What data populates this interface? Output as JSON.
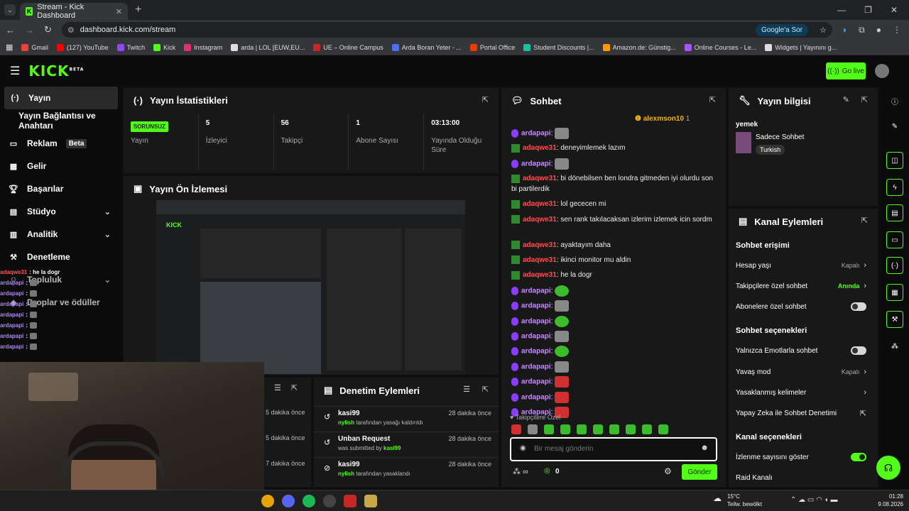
{
  "browser": {
    "tab_title": "Stream - Kick Dashboard",
    "url": "dashboard.kick.com/stream",
    "google_sor": "Google'a Sor",
    "bookmarks": [
      "Gmail",
      "(127) YouTube",
      "Twitch",
      "Kick",
      "Instagram",
      "arda | LOL [EUW,EU...",
      "UE – Online Campus",
      "Arda Boran Yeter - ...",
      "Portal Office",
      "Student Discounts |...",
      "Amazon.de: Günstig...",
      "Online Courses - Le...",
      "Widgets | Yayınını g..."
    ],
    "bookmark_colors": [
      "#ea4335",
      "#ff0000",
      "#9146ff",
      "#53fc18",
      "#e1306c",
      "#dddddd",
      "#c62828",
      "#4c6ef5",
      "#eb3c00",
      "#16c2a3",
      "#ff9900",
      "#a855f7",
      "#dddddd"
    ]
  },
  "header": {
    "logo": "KICK",
    "logo_sup": "BETA",
    "go_live": "Go live"
  },
  "sidebar": {
    "items": [
      "Yayın",
      "Yayın Bağlantısı ve Anahtarı",
      "Reklam",
      "Gelir",
      "Başarılar",
      "Stüdyo",
      "Analitik",
      "Denetleme",
      "Topluluk",
      "Droplar ve ödüller"
    ],
    "beta": "Beta"
  },
  "overlay_chat": [
    {
      "name": "adaqwe31",
      "text": ": he la dogr",
      "red": true
    },
    {
      "name": "ardapapi",
      "text": ":"
    },
    {
      "name": "ardapapi",
      "text": ":"
    },
    {
      "name": "ardapapi",
      "text": ":"
    },
    {
      "name": "ardapapi",
      "text": ":"
    },
    {
      "name": "ardapapi",
      "text": ":"
    },
    {
      "name": "ardapapi",
      "text": ":"
    },
    {
      "name": "ardapapi",
      "text": ":"
    }
  ],
  "stats": {
    "title": "Yayın İstatistikleri",
    "status_badge": "SORUNSUZ",
    "items": [
      {
        "value": "",
        "label": "Yayın"
      },
      {
        "value": "5",
        "label": "İzleyici"
      },
      {
        "value": "56",
        "label": "Takipçi"
      },
      {
        "value": "1",
        "label": "Abone Sayısı"
      },
      {
        "value": "03:13:00",
        "label": "Yayında Olduğu Süre"
      }
    ]
  },
  "preview": {
    "title": "Yayın Ön İzlemesi"
  },
  "left_partial": {
    "times": [
      "5 dakika önce",
      "5 dakika önce",
      "7 dakika önce"
    ]
  },
  "moderation": {
    "title": "Denetim Eylemleri",
    "rows": [
      {
        "name": "kasi99",
        "by": "nylish",
        "rest": " tarafından yasağı kaldırıldı",
        "time": "28 dakika önce"
      },
      {
        "name": "Unban Request",
        "by": "was submitted by ",
        "rest": "kasi99",
        "time": "28 dakika önce"
      },
      {
        "name": "kasi99",
        "by": "nylish",
        "rest": " tarafından yasaklandı",
        "time": "28 dakika önce"
      }
    ]
  },
  "chat": {
    "title": "Sohbet",
    "pinned_user": "alexmson10",
    "pinned_count": "1",
    "messages": [
      {
        "name": "ardapapi",
        "text": ": ",
        "color": "p",
        "emote": "gray"
      },
      {
        "name": "adaqwe31",
        "text": ": deneyimlemek lazım",
        "color": "r",
        "emote": ""
      },
      {
        "name": "ardapapi",
        "text": ": ",
        "color": "p",
        "emote": "gray"
      },
      {
        "name": "adaqwe31",
        "text": ": bi dönebilsen ben londra gitmeden iyi olurdu son bi partilerdik",
        "color": "r",
        "emote": ""
      },
      {
        "name": "adaqwe31",
        "text": ": lol gececen mi",
        "color": "r",
        "emote": ""
      },
      {
        "name": "adaqwe31",
        "text": ": sen rank takılacaksan izlerim izlemek icin sordm",
        "color": "r",
        "emote": ""
      },
      {
        "name": "adaqwe31",
        "text": ": ayaktayım daha",
        "color": "r",
        "emote": ""
      },
      {
        "name": "adaqwe31",
        "text": ": ikinci monitor mu aldin",
        "color": "r",
        "emote": ""
      },
      {
        "name": "adaqwe31",
        "text": ": he la dogr",
        "color": "r",
        "emote": ""
      },
      {
        "name": "ardapapi",
        "text": ": ",
        "color": "p",
        "emote": "green"
      },
      {
        "name": "ardapapi",
        "text": ": ",
        "color": "p",
        "emote": "gray"
      },
      {
        "name": "ardapapi",
        "text": ": ",
        "color": "p",
        "emote": "green"
      },
      {
        "name": "ardapapi",
        "text": ": ",
        "color": "p",
        "emote": "gray"
      },
      {
        "name": "ardapapi",
        "text": ": ",
        "color": "p",
        "emote": "green"
      },
      {
        "name": "ardapapi",
        "text": ": ",
        "color": "p",
        "emote": "gray"
      },
      {
        "name": "ardapapi",
        "text": ": ",
        "color": "p",
        "emote": "red"
      },
      {
        "name": "ardapapi",
        "text": ": ",
        "color": "p",
        "emote": "red"
      },
      {
        "name": "ardapapi",
        "text": ": ",
        "color": "p",
        "emote": "red"
      }
    ],
    "followers_only": "Takipçilere Özel",
    "placeholder": "Bir mesaj gönderin",
    "points": "0",
    "send": "Gönder"
  },
  "stream_info": {
    "title": "Yayın bilgisi",
    "stream_title": "yemek",
    "category": "Sadece Sohbet",
    "tag": "Turkish"
  },
  "channel_actions": {
    "title": "Kanal Eylemleri",
    "chat_access": "Sohbet erişimi",
    "account_age": "Hesap yaşı",
    "account_age_val": "Kapalı",
    "followers_only": "Takipçilere özel sohbet",
    "followers_only_val": "Anında",
    "subs_only": "Abonelere özel sohbet",
    "chat_options": "Sohbet seçenekleri",
    "emotes_only": "Yalnızca Emotlarla sohbet",
    "slow_mode": "Yavaş mod",
    "slow_mode_val": "Kapalı",
    "banned_words": "Yasaklanmış kelimeler",
    "ai_moderation": "Yapay Zeka ile Sohbet Denetimi",
    "channel_options": "Kanal seçenekleri",
    "show_viewers": "İzlenme sayısını göster",
    "raid": "Raid Kanalı"
  },
  "taskbar": {
    "temp": "15°C",
    "weather": "Teilw. bewölkt",
    "time": "01:28",
    "date": "9.08.2026"
  }
}
